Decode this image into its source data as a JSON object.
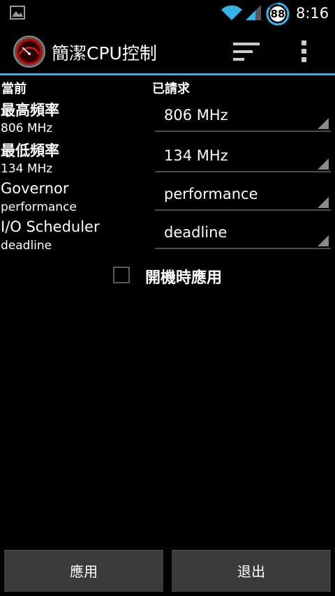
{
  "status_bar": {
    "time": "8:16",
    "battery_level": "88",
    "icons": [
      "gallery-icon",
      "wifi-icon",
      "signal-icon",
      "battery-icon"
    ]
  },
  "action_bar": {
    "title": "簡潔CPU控制",
    "icons": [
      "app-speedometer-icon",
      "sort-icon",
      "overflow-menu-icon"
    ],
    "accent_color": "#33b5e5"
  },
  "headers": {
    "current": "當前",
    "requested": "已請求"
  },
  "rows": [
    {
      "title": "最高頻率",
      "current": "806 MHz",
      "requested": "806 MHz"
    },
    {
      "title": "最低頻率",
      "current": "134 MHz",
      "requested": "134 MHz"
    },
    {
      "title": "Governor",
      "current": "performance",
      "requested": "performance"
    },
    {
      "title": "I/O Scheduler",
      "current": "deadline",
      "requested": "deadline"
    }
  ],
  "apply_on_boot": {
    "label": "開機時應用",
    "checked": false
  },
  "buttons": {
    "apply": "應用",
    "exit": "退出"
  }
}
